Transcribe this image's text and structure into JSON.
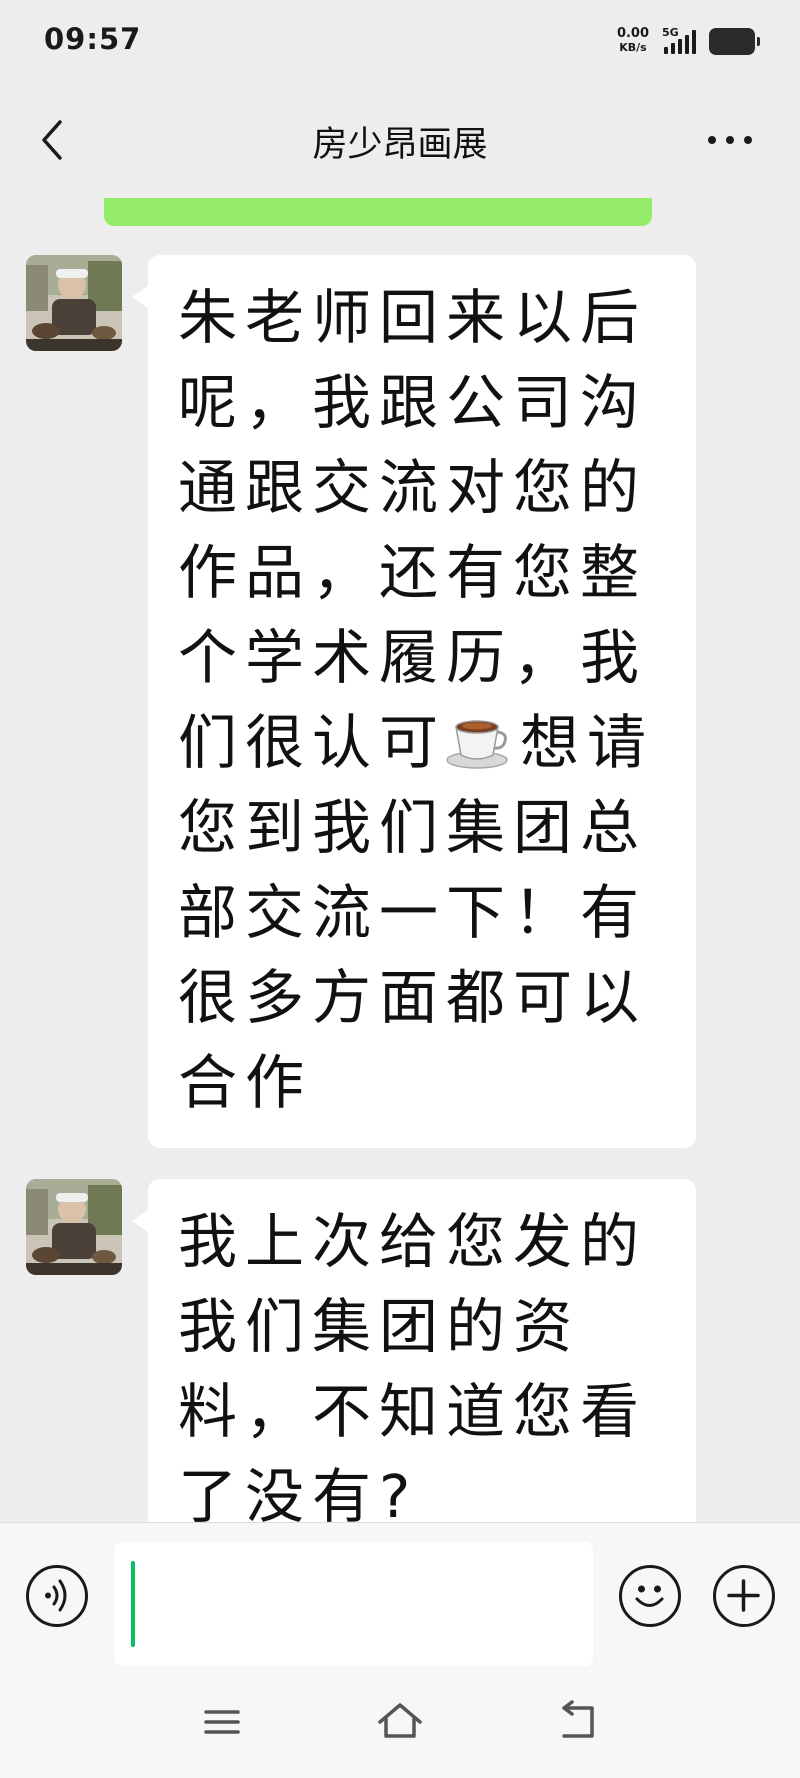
{
  "status_bar": {
    "time": "09:57",
    "net_speed_value": "0.00",
    "net_speed_unit": "KB/s",
    "network_type": "5G",
    "icons": [
      "signal-icon",
      "battery-icon"
    ]
  },
  "header": {
    "title": "房少昂画展",
    "back_icon": "chevron-left-icon",
    "more_icon": "more-dots-icon"
  },
  "messages": [
    {
      "sender_side": "left",
      "text_before_emoji": "朱老师回来以后呢，我跟公司沟通跟交流对您的作品，还有您整个学术履历，我们很认可",
      "emoji": "coffee-cup-icon",
      "text_after_emoji": "想请您到我们集团总部交流一下！有很多方面都可以合作"
    },
    {
      "sender_side": "left",
      "text": "我上次给您发的我们集团的资料，不知道您看了没有?"
    }
  ],
  "input_bar": {
    "value": "",
    "icons": [
      "voice-icon",
      "emoji-icon",
      "plus-icon"
    ]
  },
  "system_nav": {
    "icons": [
      "menu-icon",
      "home-icon",
      "back-icon"
    ]
  },
  "colors": {
    "background": "#ededed",
    "bubble": "#ffffff",
    "sent_bubble_green": "#95ec69",
    "caret": "#07c160"
  }
}
